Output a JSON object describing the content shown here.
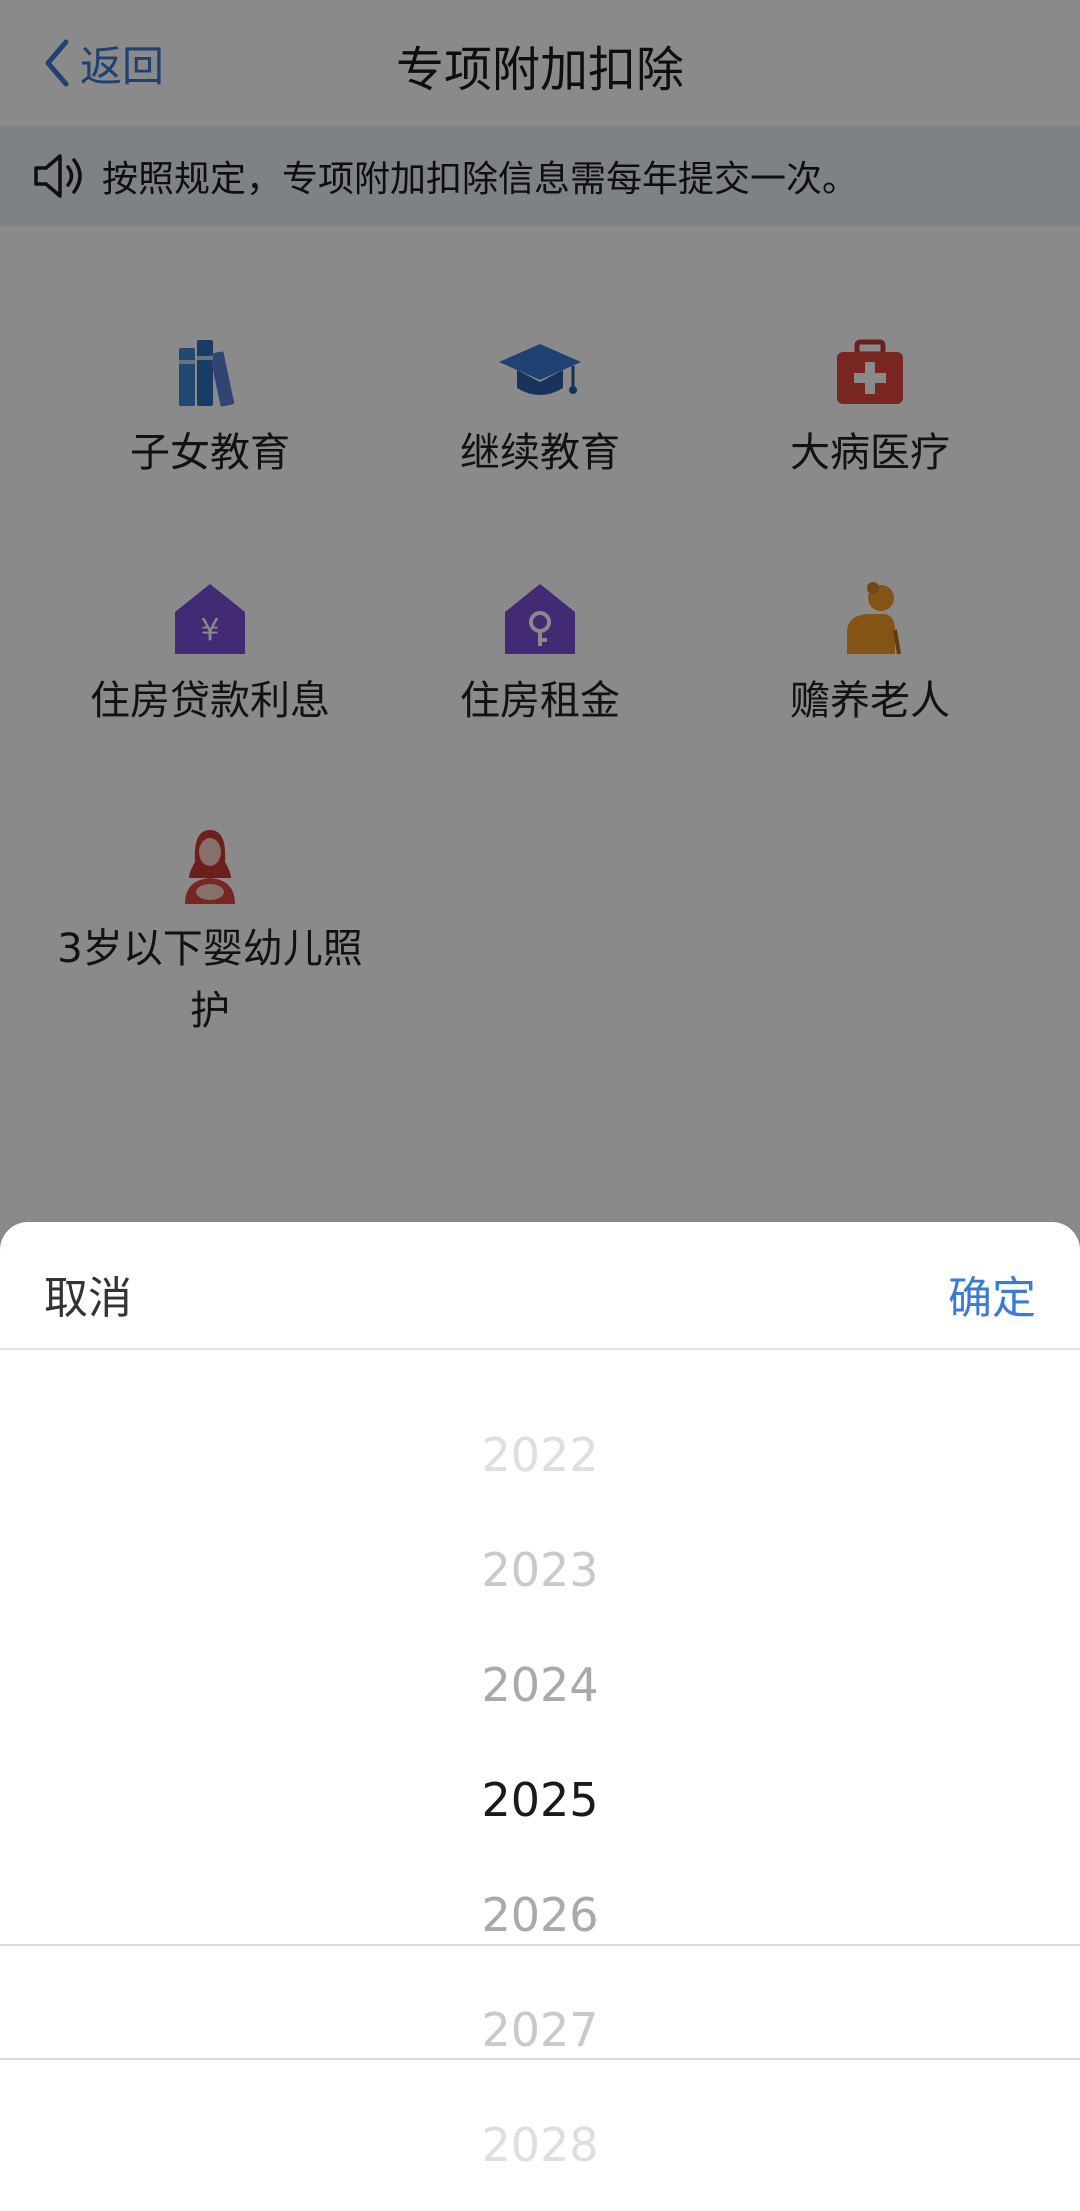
{
  "header": {
    "back_label": "返回",
    "title": "专项附加扣除"
  },
  "notice": {
    "text": "按照规定，专项附加扣除信息需每年提交一次。"
  },
  "categories": [
    {
      "label": "子女教育",
      "icon": "books-icon",
      "color": "#4a90d9"
    },
    {
      "label": "继续教育",
      "icon": "graduation-cap-icon",
      "color": "#3a7bd5"
    },
    {
      "label": "大病医疗",
      "icon": "medical-kit-icon",
      "color": "#e0463f"
    },
    {
      "label": "住房贷款利息",
      "icon": "house-yuan-icon",
      "color": "#7b4fd6"
    },
    {
      "label": "住房租金",
      "icon": "house-key-icon",
      "color": "#7b4fd6"
    },
    {
      "label": "赡养老人",
      "icon": "elderly-person-icon",
      "color": "#f39c24"
    },
    {
      "label": "3岁以下婴幼儿照护",
      "icon": "mother-baby-icon",
      "color": "#e0463f"
    }
  ],
  "picker": {
    "cancel_label": "取消",
    "confirm_label": "确定",
    "years": [
      "2022",
      "2023",
      "2024",
      "2025",
      "2026",
      "2027",
      "2028"
    ],
    "selected": "2025"
  }
}
